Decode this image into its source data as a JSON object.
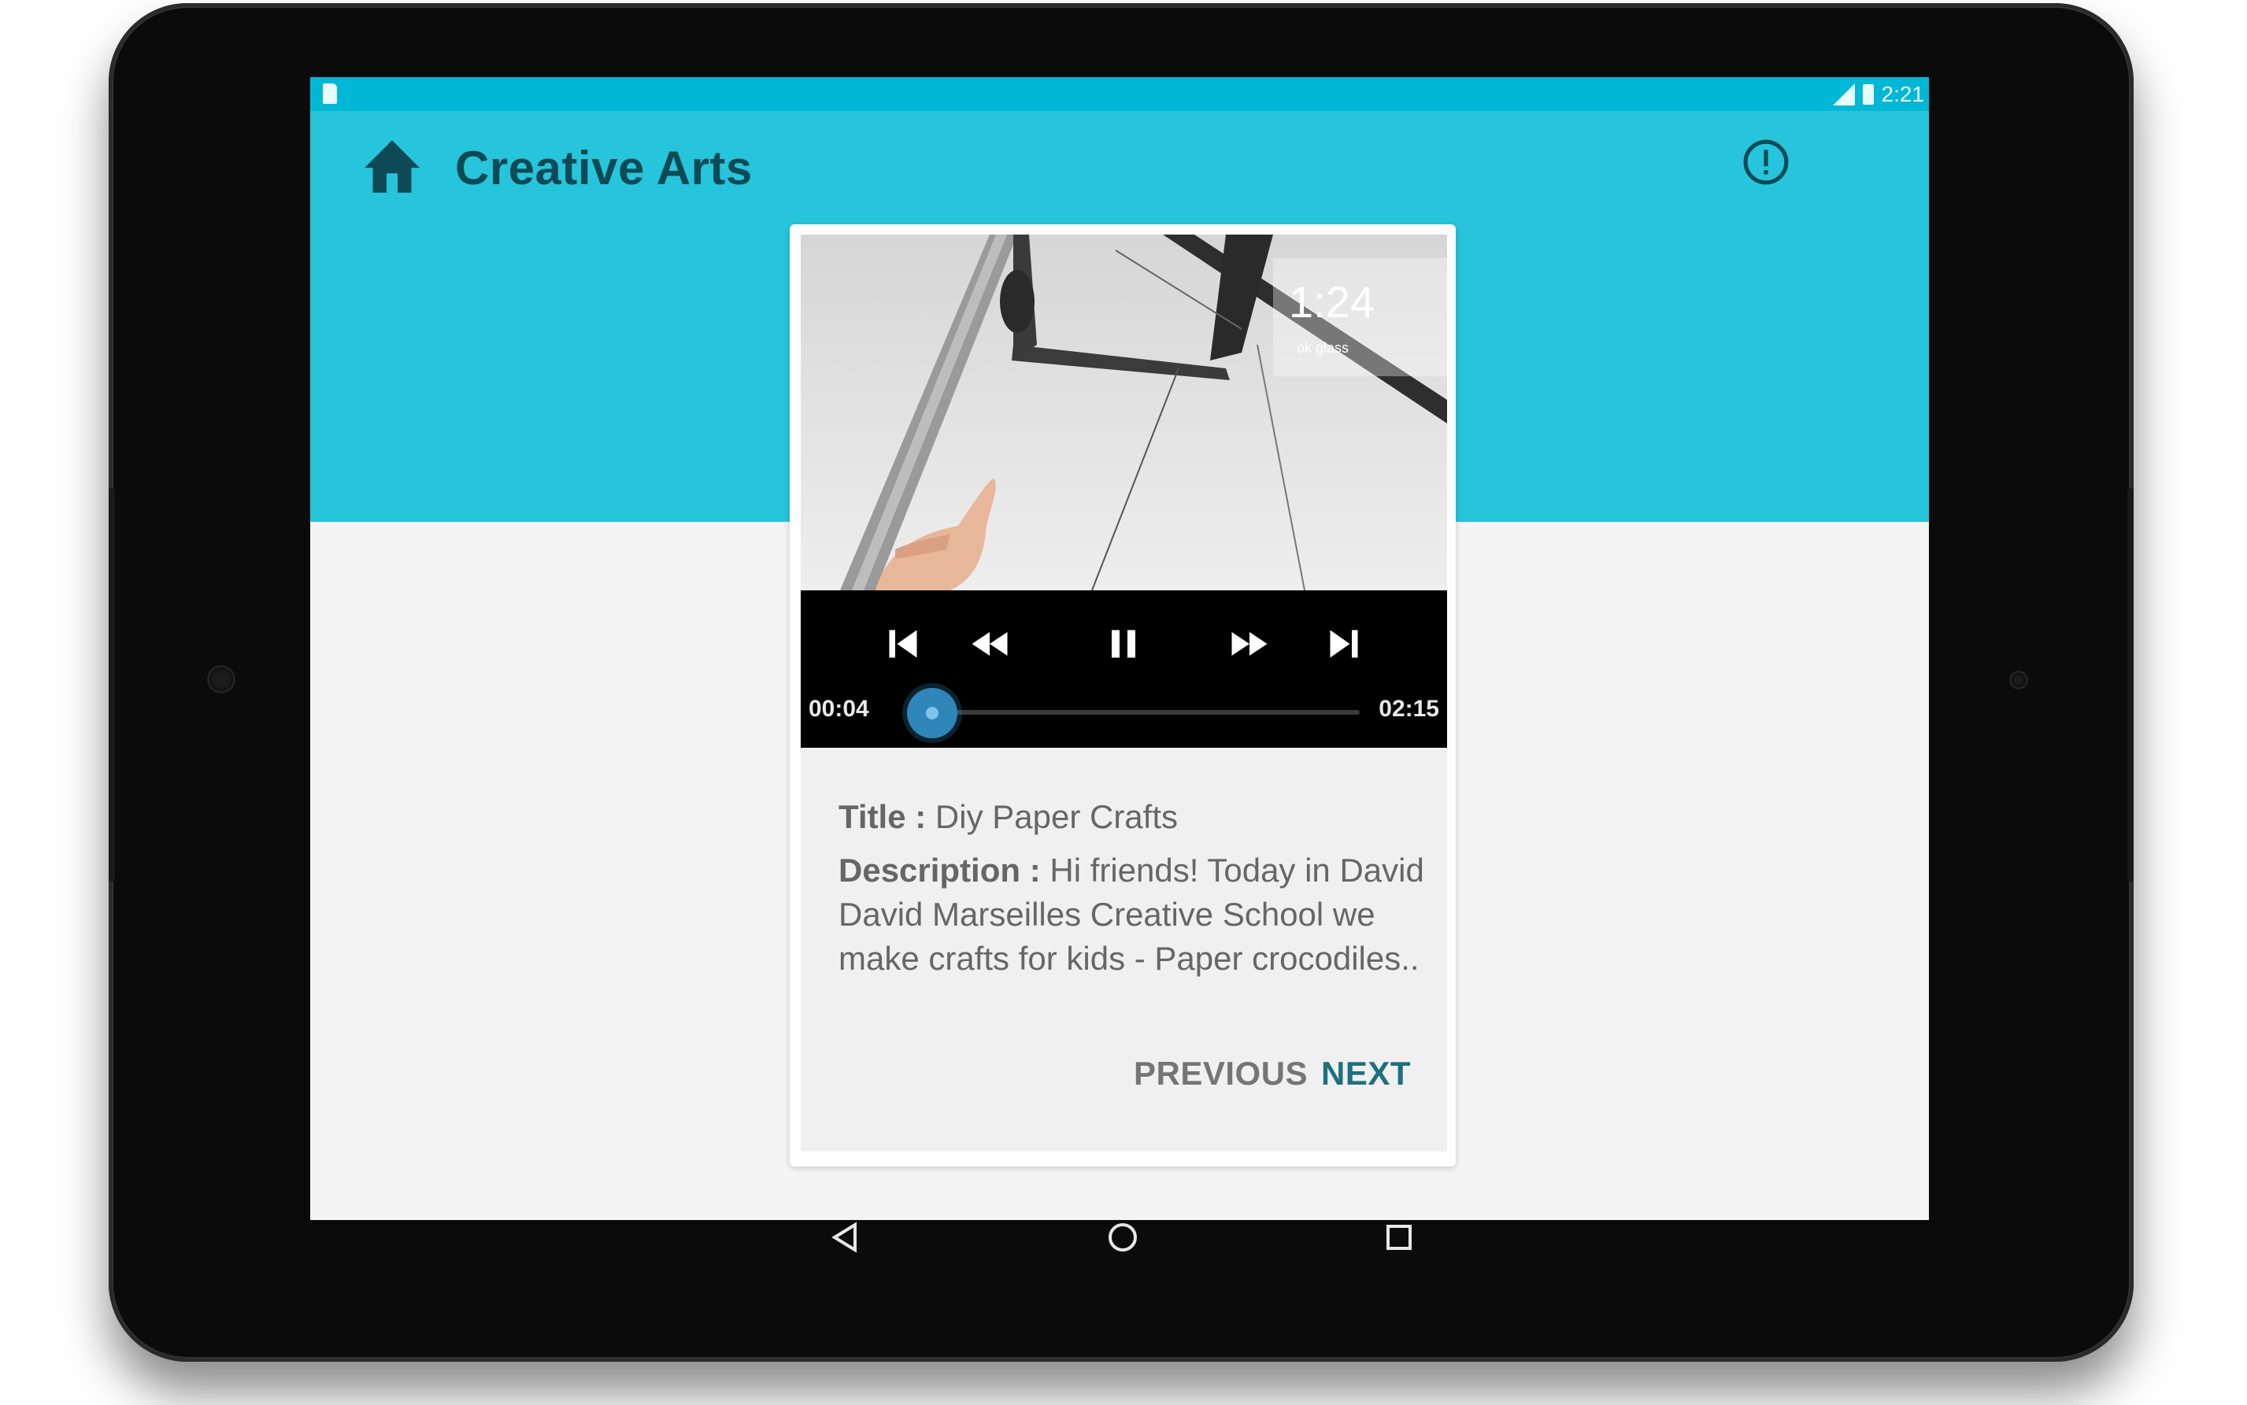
{
  "status_bar": {
    "time": "2:21"
  },
  "app_bar": {
    "title": "Creative Arts",
    "home_icon": "home-icon",
    "info_icon": "alert-circle-icon",
    "color": "#26c5dc",
    "title_color": "#0e4a55"
  },
  "video": {
    "overlay_text": "1:24",
    "overlay_subtext": "ok glass",
    "current_time": "00:04",
    "total_time": "02:15",
    "progress_fraction": 0.03,
    "controls": [
      "skip-previous-icon",
      "rewind-icon",
      "pause-icon",
      "fast-forward-icon",
      "skip-next-icon"
    ],
    "accent": "#2f86b8"
  },
  "details": {
    "title_label": "Title :",
    "title_value": "Diy Paper Crafts",
    "description_label": "Description :",
    "description_value": "Hi friends! Today in David David Marseilles Creative  School we make crafts for kids - Paper crocodiles.."
  },
  "actions": {
    "previous_label": "PREVIOUS",
    "next_label": "NEXT",
    "next_color": "#1e6f80"
  },
  "nav_bar": {
    "icons": [
      "back-icon",
      "home-circle-icon",
      "recents-icon"
    ]
  }
}
